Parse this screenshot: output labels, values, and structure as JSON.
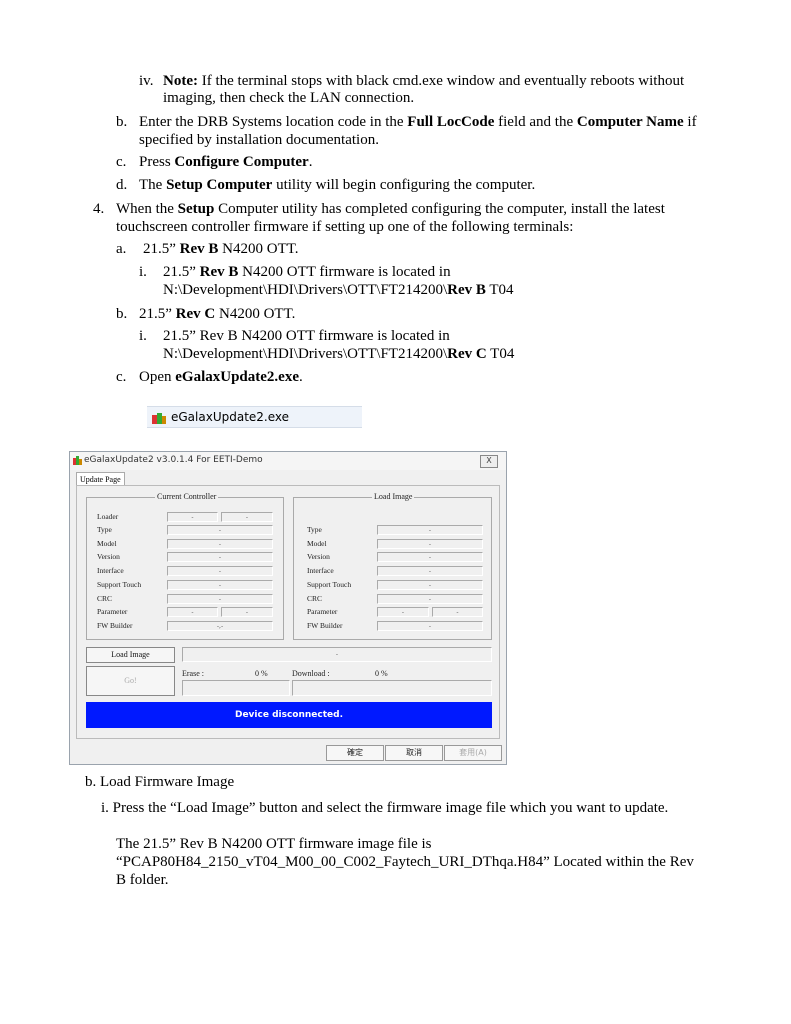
{
  "lines": {
    "iv_marker": "iv.",
    "iv_note_bold": "Note:",
    "iv_text1": " If the terminal stops with black cmd.exe window and eventually reboots without",
    "iv_text2": "imaging, then check the LAN connection.",
    "b_marker": "b.",
    "b_t1": "Enter the DRB Systems location code in the ",
    "b_bold1": "Full LocCode",
    "b_t2": " field and the ",
    "b_bold2": "Computer Name",
    "b_t3": " if",
    "b_line2": "specified by installation documentation.",
    "c_marker": "c.",
    "c_t1": "Press ",
    "c_bold": "Configure Computer",
    "c_t2": ".",
    "d_marker": "d.",
    "d_t1": "The ",
    "d_bold": "Setup Computer",
    "d_t2": " utility will begin configuring the computer.",
    "n4_marker": "4.",
    "n4_t1": "When the ",
    "n4_bold": "Setup",
    "n4_t2": " Computer utility has completed configuring the computer, install the latest",
    "n4_line2": "touchscreen controller firmware if setting up one of the following terminals:",
    "a_marker": "a.",
    "a_t1": "21.5” ",
    "a_bold": "Rev B",
    "a_t2": " N4200 OTT.",
    "ai_marker": "i.",
    "ai_t1": "21.5” ",
    "ai_bold": "Rev B",
    "ai_t2": " N4200 OTT firmware is located in",
    "ai_path1": "N:\\Development\\HDI\\Drivers\\OTT\\FT214200\\",
    "ai_path_bold": "Rev  B",
    "ai_path2": " T04",
    "b2_marker": "b.",
    "b2_t1": "21.5” ",
    "b2_bold": "Rev C",
    "b2_t2": " N4200 OTT.",
    "bi_marker": "i.",
    "bi_t1": "21.5” Rev B N4200 OTT firmware is located in",
    "bi_path1": "N:\\Development\\HDI\\Drivers\\OTT\\FT214200\\",
    "bi_path_bold": "Rev  C",
    "bi_path2": " T04",
    "c2_marker": "c.",
    "c2_t1": "Open ",
    "c2_bold": "eGalaxUpdate2.exe",
    "c2_t2": ".",
    "load_fw": "b. Load Firmware Image",
    "press_load": "i. Press the “Load Image” button and select the firmware image file which you want to update.",
    "fw_file_l1": "The 21.5” Rev B N4200 OTT firmware image file is",
    "fw_file_l2": "“PCAP80H84_2150_vT04_M00_00_C002_Faytech_URI_DThqa.H84”  Located within the Rev",
    "fw_file_l3": "B folder."
  },
  "file_strip": {
    "filename": "eGalaxUpdate2.exe",
    "icon": "egalax-app-icon"
  },
  "dialog": {
    "title": "eGalaxUpdate2 v3.0.1.4 For EETI-Demo",
    "close": "X",
    "tab": "Update Page",
    "current_controller": {
      "label": "Current Controller",
      "rows": [
        "Loader",
        "Type",
        "Model",
        "Version",
        "Interface",
        "Support Touch",
        "CRC",
        "Parameter",
        "FW Builder"
      ],
      "values": [
        "-",
        "-",
        "-",
        "-",
        "-",
        "-",
        "-",
        "-",
        "-",
        "-",
        "-",
        "-,-"
      ]
    },
    "load_image": {
      "label": "Load Image",
      "rows": [
        "Type",
        "Model",
        "Version",
        "Interface",
        "Support Touch",
        "CRC",
        "Parameter",
        "FW Builder"
      ],
      "values": [
        "-",
        "-",
        "-",
        "-",
        "-",
        "-",
        "-",
        "-",
        "-"
      ]
    },
    "load_image_button": "Load Image",
    "path_value": "-",
    "go_button": "Go!",
    "erase_label": "Erase :",
    "erase_pct": "0 %",
    "download_label": "Download :",
    "download_pct": "0 %",
    "status": "Device disconnected.",
    "ok": "確定",
    "cancel": "取消",
    "apply": "套用(A)"
  }
}
